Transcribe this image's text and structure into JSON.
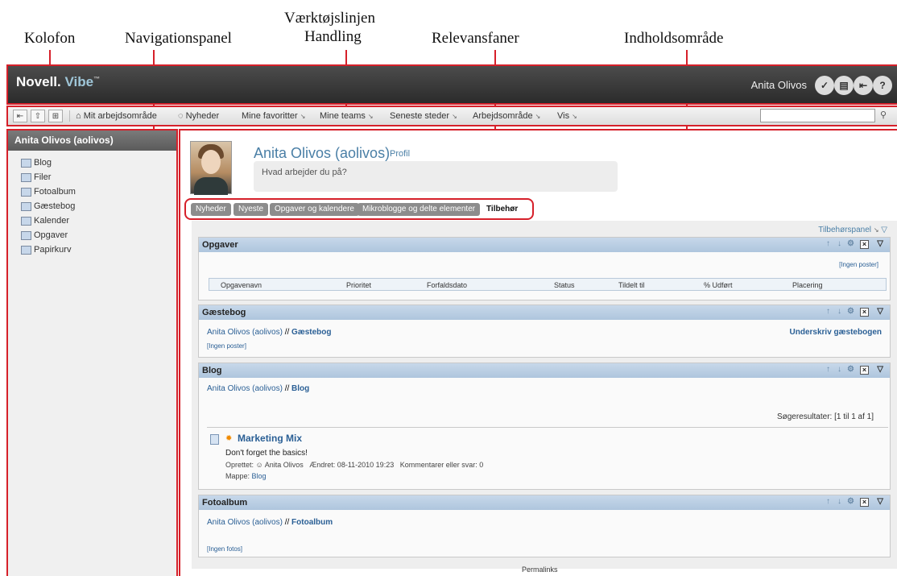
{
  "annotations": {
    "kolofon": "Kolofon",
    "navigationspanel": "Navigationspanel",
    "toolbar_line1": "Værktøjslinjen",
    "toolbar_line2": "Handling",
    "relevansfaner": "Relevansfaner",
    "indholdsomraade": "Indholdsområde"
  },
  "masthead": {
    "logo_brand": "Novell.",
    "logo_product": "Vibe",
    "logo_tm": "™",
    "user_name": "Anita Olivos",
    "icons": [
      "person-check-icon",
      "note-icon",
      "logout-icon",
      "help-icon"
    ]
  },
  "toolbar": {
    "items": [
      {
        "label": "Mit arbejdsområde",
        "has_arrow": false
      },
      {
        "label": "Nyheder",
        "has_arrow": false
      },
      {
        "label": "Mine favoritter",
        "has_arrow": true
      },
      {
        "label": "Mine teams",
        "has_arrow": true
      },
      {
        "label": "Seneste steder",
        "has_arrow": true
      },
      {
        "label": "Arbejdsområde",
        "has_arrow": true
      },
      {
        "label": "Vis",
        "has_arrow": true
      }
    ],
    "arrow_glyph": "↘"
  },
  "nav": {
    "title": "Anita Olivos (aolivos)",
    "items": [
      "Blog",
      "Filer",
      "Fotoalbum",
      "Gæstebog",
      "Kalender",
      "Opgaver",
      "Papirkurv"
    ]
  },
  "profile": {
    "name": "Anita Olivos (aolivos)",
    "profile_link": "Profil",
    "status_placeholder": "Hvad arbejder du på?"
  },
  "tabs": [
    "Nyheder",
    "Nyeste",
    "Opgaver og kalendere",
    "Mikroblogge og delte elementer",
    "Tilbehør"
  ],
  "active_tab": "Tilbehør",
  "accessory": {
    "panel_link": "Tilbehørspanel",
    "tasks": {
      "title": "Opgaver",
      "no_entries": "[Ingen poster]",
      "columns": [
        "Opgavenavn",
        "Prioritet",
        "Forfaldsdato",
        "Status",
        "Tildelt til",
        "% Udført",
        "Placering"
      ]
    },
    "guestbook": {
      "title": "Gæstebog",
      "breadcrumb_user": "Anita Olivos (aolivos)",
      "breadcrumb_sep": " // ",
      "breadcrumb_target": "Gæstebog",
      "sign_link": "Underskriv gæstebogen",
      "no_entries": "[Ingen poster]"
    },
    "blog": {
      "title": "Blog",
      "breadcrumb_user": "Anita Olivos (aolivos)",
      "breadcrumb_sep": " // ",
      "breadcrumb_target": "Blog",
      "results": "Søgeresultater: [1 til 1 af 1]",
      "entry_title": "Marketing Mix",
      "entry_text": "Don't forget the basics!",
      "created_label": "Oprettet:",
      "author": "Anita Olivos",
      "modified": "Ændret: 08-11-2010 19:23",
      "comments": "Kommentarer eller svar: 0",
      "folder_label": "Mappe:",
      "folder": "Blog"
    },
    "photo": {
      "title": "Fotoalbum",
      "breadcrumb_user": "Anita Olivos (aolivos)",
      "breadcrumb_sep": " // ",
      "breadcrumb_target": "Fotoalbum",
      "no_photos": "[Ingen fotos]"
    }
  },
  "footer": {
    "permalinks": "Permalinks"
  }
}
